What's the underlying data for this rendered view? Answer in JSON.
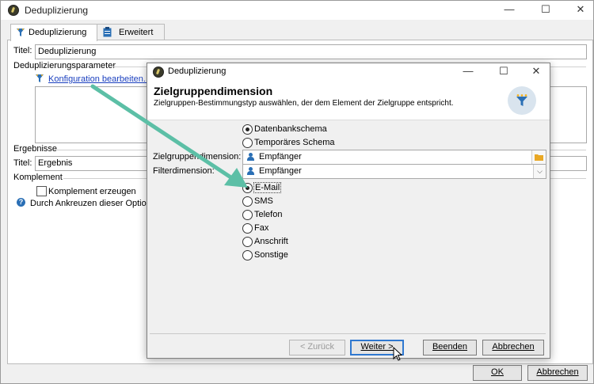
{
  "outer": {
    "title": "Deduplizierung",
    "tabs": [
      "Deduplizierung",
      "Erweitert"
    ],
    "titel_label": "Titel:",
    "titel_value": "Deduplizierung",
    "params_group": "Deduplizierungsparameter",
    "config_link": "Konfiguration bearbeiten...",
    "results_group": "Ergebnisse",
    "results_titel_label": "Titel:",
    "results_titel_value": "Ergebnis",
    "complement_group": "Komplement",
    "complement_checkbox": "Komplement erzeugen",
    "complement_hint": "Durch Ankreuzen dieser Option v",
    "ok": "OK",
    "cancel": "Abbrechen"
  },
  "dialog": {
    "title": "Deduplizierung",
    "heading": "Zielgruppendimension",
    "subheading": "Zielgruppen-Bestimmungstyp auswählen, der dem Element der Zielgruppe entspricht.",
    "schema_options": [
      {
        "label": "Datenbankschema",
        "selected": true
      },
      {
        "label": "Temporäres Schema",
        "selected": false
      }
    ],
    "target_dimension_label": "Zielgruppendimension:",
    "target_dimension_value": "Empfänger",
    "filter_dimension_label": "Filterdimension:",
    "filter_dimension_value": "Empfänger",
    "channel_options": [
      {
        "label": "E-Mail",
        "selected": true
      },
      {
        "label": "SMS",
        "selected": false
      },
      {
        "label": "Telefon",
        "selected": false
      },
      {
        "label": "Fax",
        "selected": false
      },
      {
        "label": "Anschrift",
        "selected": false
      },
      {
        "label": "Sonstige",
        "selected": false
      }
    ],
    "buttons": {
      "back": "< Zurück",
      "next": "Weiter >",
      "finish": "Beenden",
      "cancel": "Abbrechen"
    }
  },
  "colors": {
    "arrow": "#5cbfa6",
    "link": "#1a3fbf",
    "funnel_primary": "#2a6fb5",
    "funnel_accent": "#f2b01e"
  }
}
